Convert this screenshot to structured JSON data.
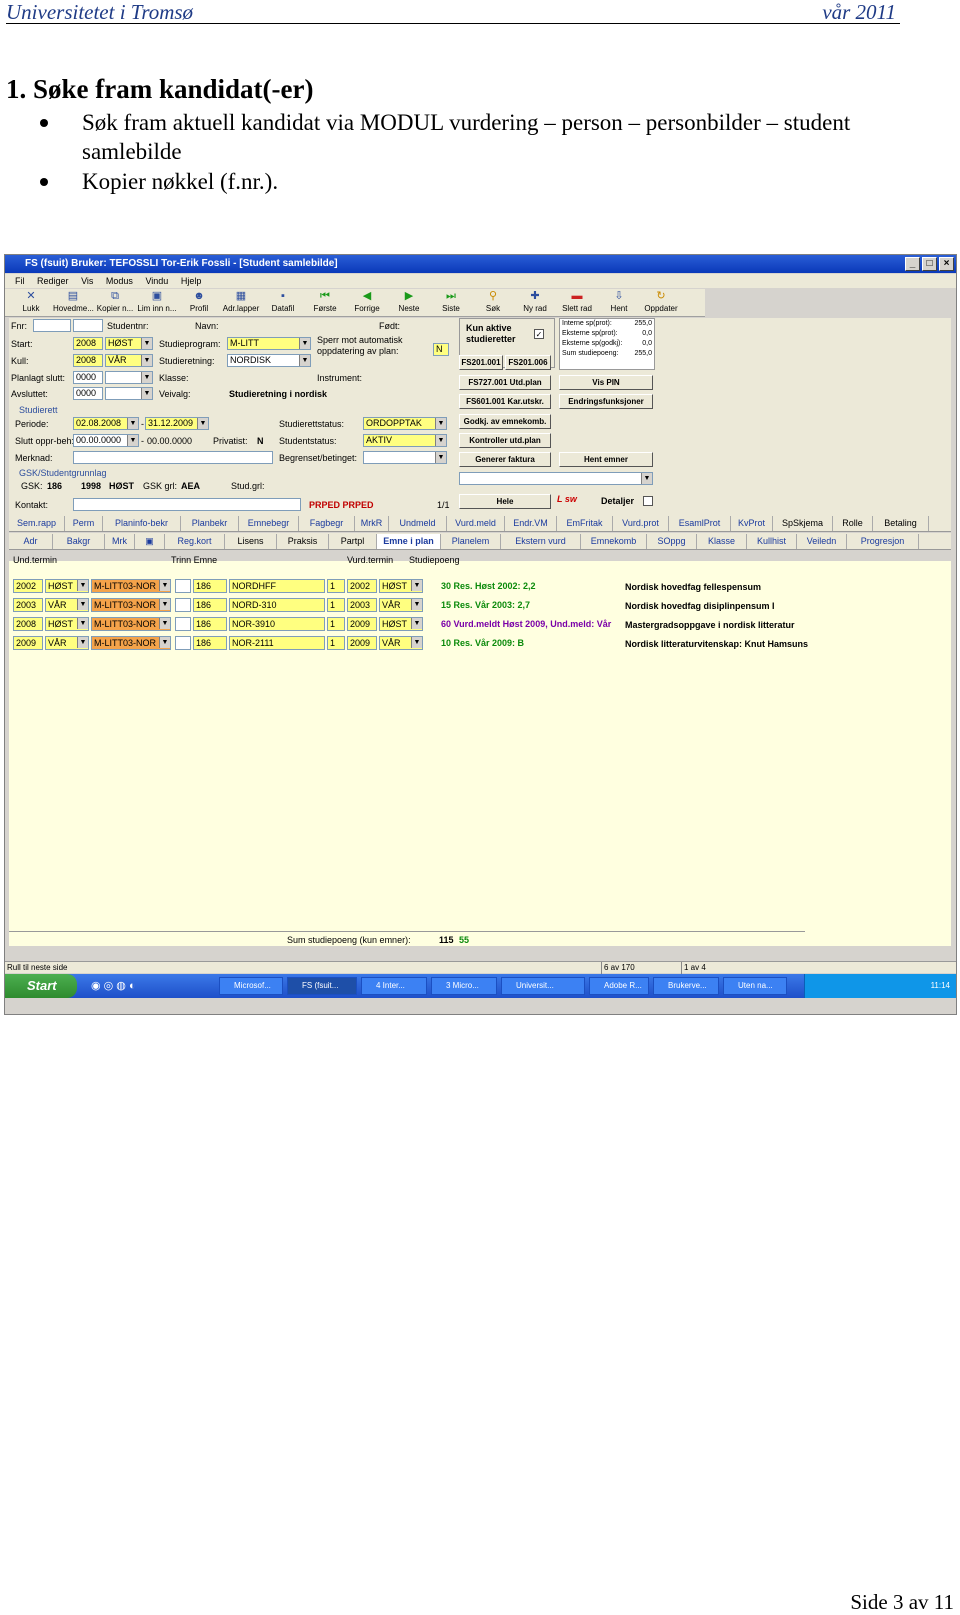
{
  "header": {
    "left": "Universitetet i Tromsø",
    "right": "vår 2011"
  },
  "heading": "1. Søke fram kandidat(-er)",
  "bullets": [
    "Søk fram aktuell kandidat via MODUL vurdering – person – personbilder – student",
    "samlebilde",
    "Kopier nøkkel (f.nr.)."
  ],
  "footer": "Side 3 av 11",
  "app": {
    "title": "FS (fsuit) Bruker: TEFOSSLI Tor-Erik Fossli - [Student samlebilde]",
    "menu": [
      "Fil",
      "Rediger",
      "Vis",
      "Modus",
      "Vindu",
      "Hjelp"
    ],
    "toolbar": [
      "Lukk",
      "Hovedme...",
      "Kopier n...",
      "Lim inn n...",
      "Profil",
      "Adr.lapper",
      "Datafil",
      "Første",
      "Forrige",
      "Neste",
      "Siste",
      "Søk",
      "Ny rad",
      "Slett rad",
      "Hent",
      "Oppdater"
    ],
    "form": {
      "fnr_label": "Fnr:",
      "studentnr_label": "Studentnr:",
      "navn_label": "Navn:",
      "fodt_label": "Født:",
      "start_label": "Start:",
      "start_year": "2008",
      "start_term": "HØST",
      "studieprogram_label": "Studieprogram:",
      "studieprogram": "M-LITT",
      "sperr_label": "Sperr mot automatisk oppdatering av plan:",
      "sperr_value": "N",
      "kull_label": "Kull:",
      "kull_year": "2008",
      "kull_term": "VÅR",
      "studieretning_label": "Studieretning:",
      "studieretning": "NORDISK",
      "planlagt_label": "Planlagt slutt:",
      "planlagt": "0000",
      "klasse_label": "Klasse:",
      "instrument_label": "Instrument:",
      "avsluttet_label": "Avsluttet:",
      "avsluttet": "0000",
      "veivalg_label": "Veivalg:",
      "studieretning_text": "Studieretning i nordisk",
      "studierett_legend": "Studierett",
      "periode_label": "Periode:",
      "periode_from": "02.08.2008",
      "periode_to": "31.12.2009",
      "studierettstatus_label": "Studierettstatus:",
      "studierettstatus": "ORDOPPTAK",
      "slutt_label": "Slutt oppr-beh:",
      "slutt_from": "00.00.0000",
      "slutt_to": "00.00.0000",
      "privatist_label": "Privatist:",
      "privatist": "N",
      "studentstatus_label": "Studentstatus:",
      "studentstatus": "AKTIV",
      "merknad_label": "Merknad:",
      "begrenset_label": "Begrenset/betinget:",
      "gsk_legend": "GSK/Studentgrunnlag",
      "gsk_label": "GSK:",
      "gsk_value": "186",
      "gsk_year": "1998",
      "gsk_term": "HØST",
      "gskgrl_label": "GSK grl:",
      "gskgrl": "AEA",
      "studgrl_label": "Stud.grl:",
      "kontakt_label": "Kontakt:",
      "prped": "PRPED PRPED",
      "count": "1/1",
      "kun_aktive": "Kun aktive studieretter",
      "sp_labels": [
        "Interne sp(prot):",
        "Eksterne sp(prot):",
        "Eksterne sp(godkj):",
        "Sum studiepoeng:"
      ],
      "sp_values": [
        "255,0",
        "0,0",
        "0,0",
        "255,0"
      ],
      "buttons": [
        "FS201.001",
        "FS201.006",
        "FS727.001 Utd.plan",
        "Vis PIN",
        "FS601.001 Kar.utskr.",
        "Endringsfunksjoner",
        "Godkj. av emnekomb.",
        "Kontroller utd.plan",
        "Generer faktura",
        "Hent emner",
        "Hele"
      ],
      "detaljer": "Detaljer"
    },
    "tabs1": [
      "Sem.rapp",
      "Perm",
      "Planinfo-bekr",
      "Planbekr",
      "Emnebegr",
      "Fagbegr",
      "MrkR",
      "Undmeld",
      "Vurd.meld",
      "Endr.VM",
      "EmFritak",
      "Vurd.prot",
      "EsamlProt",
      "KvProt",
      "SpSkjema",
      "Rolle",
      "Betaling"
    ],
    "tabs2": [
      "Adr",
      "Bakgr",
      "Mrk",
      "",
      "Reg.kort",
      "Lisens",
      "Praksis",
      "Partpl",
      "Emne i plan",
      "Planelem",
      "Ekstern vurd",
      "Emnekomb",
      "SOppg",
      "Klasse",
      "Kullhist",
      "Veiledn",
      "Progresjon"
    ],
    "grid": {
      "headers": [
        "Und.termin",
        "Trinn Emne",
        "Vurd.termin",
        "Studiepoeng"
      ],
      "rows": [
        {
          "year": "2002",
          "term": "HØST",
          "prog": "M-LITT03-NOR",
          "inst": "186",
          "emne": "NORDHFF",
          "v": "1",
          "vyear": "2002",
          "vterm": "HØST",
          "result": "30 Res. Høst 2002: 2,2",
          "name": "Nordisk hovedfag fellespensum",
          "color": "#0a8a0a"
        },
        {
          "year": "2003",
          "term": "VÅR",
          "prog": "M-LITT03-NOR",
          "inst": "186",
          "emne": "NORD-310",
          "v": "1",
          "vyear": "2003",
          "vterm": "VÅR",
          "result": "15 Res. Vår 2003: 2,7",
          "name": "Nordisk hovedfag disiplinpensum I",
          "color": "#0a8a0a"
        },
        {
          "year": "2008",
          "term": "HØST",
          "prog": "M-LITT03-NOR",
          "inst": "186",
          "emne": "NOR-3910",
          "v": "1",
          "vyear": "2009",
          "vterm": "HØST",
          "result": "60 Vurd.meldt Høst 2009, Und.meld: Vår",
          "name": "Mastergradsoppgave i nordisk litteratur",
          "color": "#7a00a8"
        },
        {
          "year": "2009",
          "term": "VÅR",
          "prog": "M-LITT03-NOR",
          "inst": "186",
          "emne": "NOR-2111",
          "v": "1",
          "vyear": "2009",
          "vterm": "VÅR",
          "result": "10 Res. Vår 2009: B",
          "name": "Nordisk litteraturvitenskap: Knut Hamsuns",
          "color": "#0a8a0a"
        }
      ],
      "sum_label": "Sum studiepoeng (kun emner):",
      "sum_a": "115",
      "sum_b": "55"
    },
    "status": {
      "left": "Rull til neste side",
      "mid": "6 av 170",
      "right": "1 av 4"
    },
    "taskbar": {
      "start": "Start",
      "tasks": [
        "Microsof...",
        "FS (fsuit...",
        "4 Inter...",
        "3 Micro...",
        "Universit...",
        "Adobe R...",
        "Brukerve...",
        "Uten na..."
      ],
      "clock": "11:14"
    }
  }
}
